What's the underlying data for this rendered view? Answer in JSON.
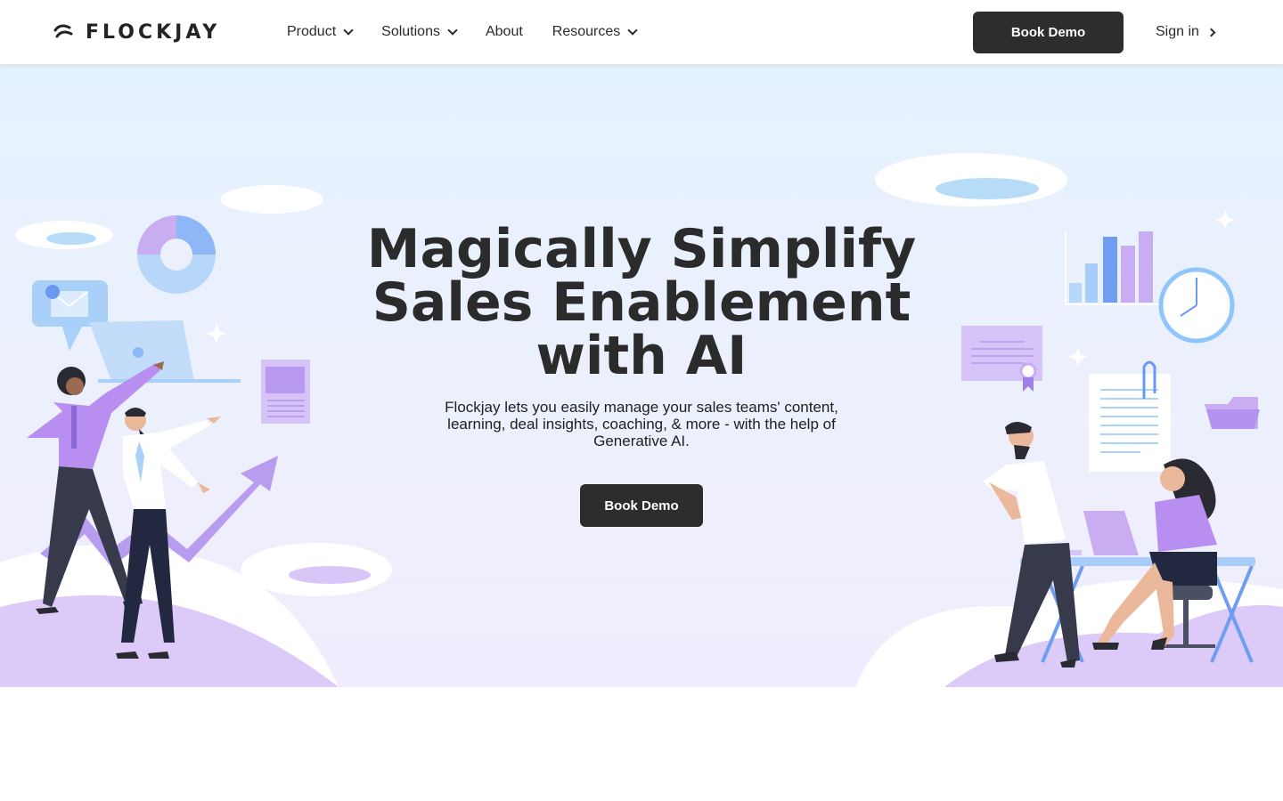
{
  "nav": {
    "logo_text": "FLOCKJAY",
    "items": [
      {
        "label": "Product",
        "dropdown": true
      },
      {
        "label": "Solutions",
        "dropdown": true
      },
      {
        "label": "About",
        "dropdown": false
      },
      {
        "label": "Resources",
        "dropdown": true
      }
    ],
    "book_demo": "Book Demo",
    "sign_in": "Sign in"
  },
  "hero": {
    "headline_line1": "Magically Simplify",
    "headline_line2": "Sales Enablement",
    "headline_line3": "with AI",
    "subtext": "Flockjay lets you easily manage your sales teams' content, learning, deal insights, coaching, & more - with the help of Generative AI.",
    "cta": "Book Demo"
  },
  "colors": {
    "dark": "#2d2d2d",
    "purple": "#b99af0",
    "blue": "#8ec5fb",
    "hero_top": "#e4f2fd",
    "hero_bottom": "#f1ecfd"
  },
  "icons": [
    "logo-icon",
    "chevron-down-icon",
    "chevron-right-icon"
  ]
}
